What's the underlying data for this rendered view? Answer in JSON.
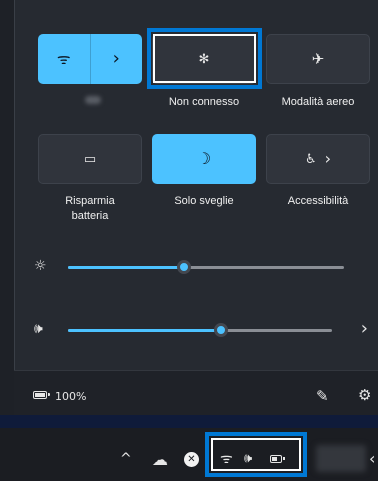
{
  "colors": {
    "accent": "#4cc2ff",
    "highlight": "#0078d4",
    "panel": "#262a31"
  },
  "tiles": {
    "wifi": {
      "icon": "wifi-icon",
      "glyph": "ᯤ",
      "chevron": "›",
      "state": "on"
    },
    "bluetooth": {
      "icon": "bluetooth-icon",
      "glyph": "✻",
      "label": "Non connesso",
      "state": "off"
    },
    "airplane": {
      "icon": "airplane-icon",
      "glyph": "✈",
      "label": "Modalità aereo",
      "state": "off"
    },
    "battery_saver": {
      "icon": "battery-saver-icon",
      "glyph": "▭",
      "label": "Risparmia batteria",
      "state": "off"
    },
    "focus": {
      "icon": "moon-icon",
      "glyph": "☽",
      "label": "Solo sveglie",
      "state": "on"
    },
    "accessibility": {
      "icon": "accessibility-icon",
      "glyph": "♿",
      "chevron": "›",
      "label": "Accessibilità",
      "state": "off"
    }
  },
  "sliders": {
    "brightness": {
      "icon": "brightness-icon",
      "glyph": "☼",
      "level": 0.42
    },
    "volume": {
      "icon": "volume-icon",
      "glyph": "🕪",
      "level": 0.58,
      "chevron": "›"
    }
  },
  "footer": {
    "battery_percent": "100%",
    "edit_icon": "✎",
    "settings_icon": "⚙"
  },
  "taskbar": {
    "chevron_up": "^",
    "cloud_icon": "☁",
    "close_glyph": "✕",
    "wifi_glyph": "ᯤ",
    "volume_glyph": "🕪",
    "edge_char": "‹"
  }
}
